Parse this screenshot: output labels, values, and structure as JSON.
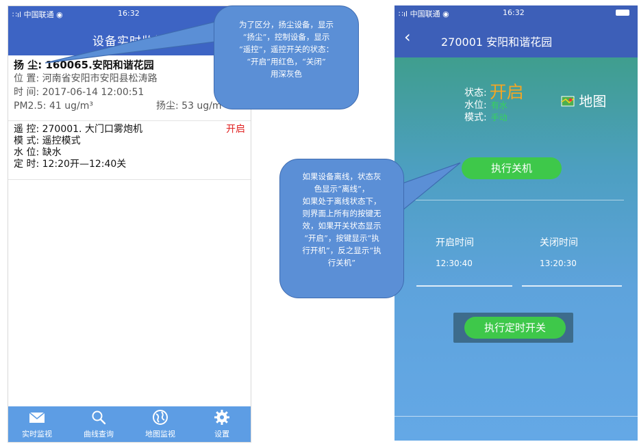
{
  "phone_left": {
    "status_bar": {
      "carrier": "∷ıl 中国联通 ◉",
      "time": "16:32"
    },
    "title": "设备实时监视",
    "dust_device": {
      "line1": "扬 尘: 160065.安阳和谐花园",
      "line2": "位   置: 河南省安阳市安阳县松涛路",
      "line3": "时   间: 2017-06-14 12:00:51",
      "pm": "PM2.5: 41 ug/m³",
      "dust": "扬尘: 53 ug/m³"
    },
    "control_device": {
      "line1": "遥 控: 270001. 大门口雾炮机",
      "status": "开启",
      "line2": "模 式: 遥控模式",
      "line3": "水 位: 缺水",
      "line4": "定 时: 12:20开—12:40关"
    },
    "tabs": [
      {
        "label": "实时监视",
        "icon": "envelope-icon"
      },
      {
        "label": "曲线查询",
        "icon": "search-icon"
      },
      {
        "label": "地图监视",
        "icon": "globe-icon"
      },
      {
        "label": "设置",
        "icon": "gear-icon"
      }
    ]
  },
  "callout_1": {
    "lines": [
      "为了区分，扬尘设备，显示",
      "“扬尘”，控制设备，显示",
      "“遥控”，遥控开关的状态：",
      "“开启”用红色，“关闭”",
      "用深灰色"
    ]
  },
  "callout_2": {
    "lines": [
      "如果设备离线，状态灰",
      "色显示“离线”，",
      "如果处于离线状态下，",
      "则界面上所有的按键无",
      "效，如果开关状态显示",
      "“开启”，按键显示“执",
      "行开机”，反之显示“执",
      "行关机”"
    ]
  },
  "phone_right": {
    "status_bar": {
      "carrier": "∷ıl 中国联通 ◉",
      "time": "16:32"
    },
    "title": "270001 安阳和谐花园",
    "status_label": "状态:",
    "status_value": "开启",
    "water_label": "水位:",
    "water_value": "有水",
    "mode_label": "模式:",
    "mode_value": "手动",
    "map_label": "地图",
    "off_button": "执行关机",
    "open_time_label": "开启时间",
    "close_time_label": "关闭时间",
    "open_time": "12:30:40",
    "close_time": "13:20:30",
    "timer_button": "执行定时开关"
  },
  "colors": {
    "nav": "#3d64c4",
    "tab_bar": "#5d9de4",
    "status_on": "#e02020",
    "status_big": "#f5a623",
    "green_text": "#36d35a",
    "button_green": "#3ec84a",
    "callout": "#5b8fd6"
  }
}
